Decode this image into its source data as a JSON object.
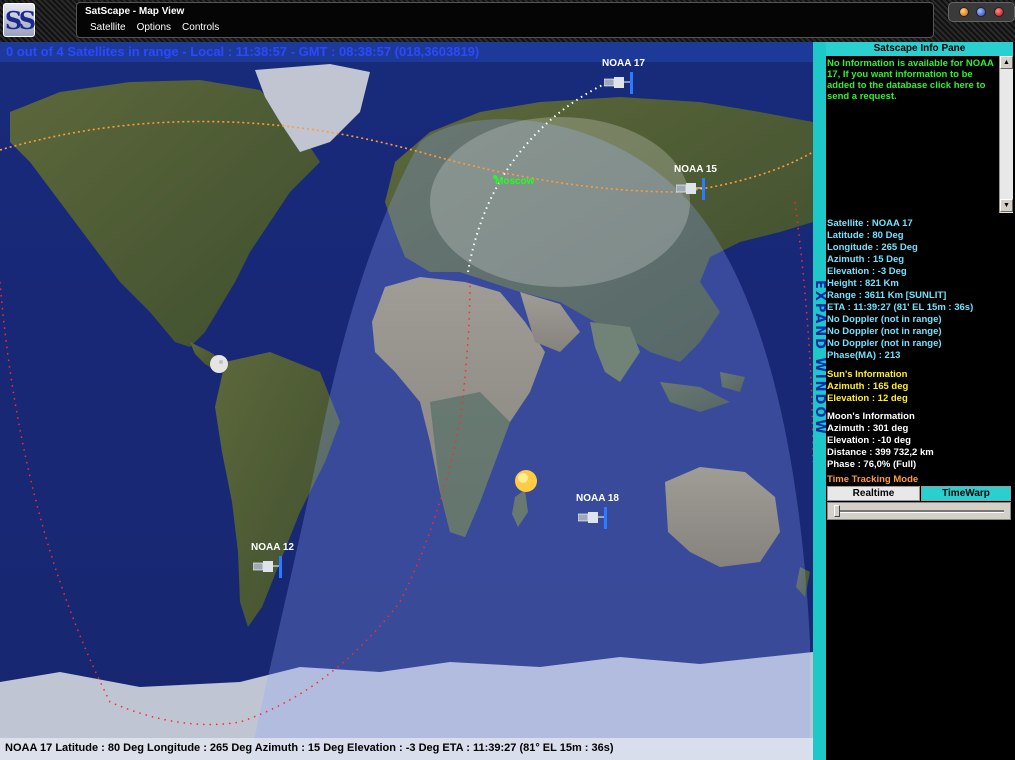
{
  "window": {
    "title": "SatScape - Map View",
    "logo_text": "SS"
  },
  "menu": {
    "items": [
      "Satellite",
      "Options",
      "Controls"
    ]
  },
  "map": {
    "status_top": "0 out of 4 Satellites in range - Local : 11:38:57 - GMT : 08:38:57 (018,3603819)",
    "status_bottom": "NOAA 17  Latitude : 80 Deg  Longitude : 265 Deg  Azimuth : 15 Deg  Elevation : -3 Deg   ETA : 11:39:27 (81° EL   15m : 36s)",
    "city_label": "Moscow",
    "satellites": [
      {
        "name": "NOAA 17"
      },
      {
        "name": "NOAA 15"
      },
      {
        "name": "NOAA 18"
      },
      {
        "name": "NOAA 12"
      }
    ]
  },
  "expand_label": "EXPAND WINDOW",
  "info_pane": {
    "header": "Satscape Info Pane",
    "message": "No Information is available for NOAA 17, If you want information to be added to the database click here to send a request.",
    "satellite_lines": [
      "Satellite : NOAA 17",
      "Latitude : 80 Deg",
      "Longitude : 265 Deg",
      "Azimuth : 15 Deg",
      "Elevation : -3 Deg",
      "Height : 821 Km",
      "Range : 3611 Km  [SUNLIT]",
      "ETA : 11:39:27 (81' EL   15m : 36s)",
      "No Doppler (not in range)",
      "No Doppler (not in range)",
      "No Doppler (not in range)",
      "Phase(MA) : 213"
    ],
    "sun_lines": [
      "Sun's Information",
      "Azimuth : 165 deg",
      "Elevation : 12 deg"
    ],
    "moon_lines": [
      "Moon's Information",
      "Azimuth : 301 deg",
      "Elevation : -10 deg",
      "Distance : 399 732,2 km",
      "Phase : 76,0% (Full)"
    ],
    "time_tracking_label": "Time Tracking Mode",
    "tabs": {
      "realtime": "Realtime",
      "timewarp": "TimeWarp"
    }
  },
  "colors": {
    "status_text": "#2b49ff",
    "accent_cyan": "#2ad0d0",
    "message_green": "#2ef02e",
    "sat_info": "#6fe3ff",
    "sun_info": "#ffee2a",
    "time_tracking": "#ff9a3a"
  }
}
